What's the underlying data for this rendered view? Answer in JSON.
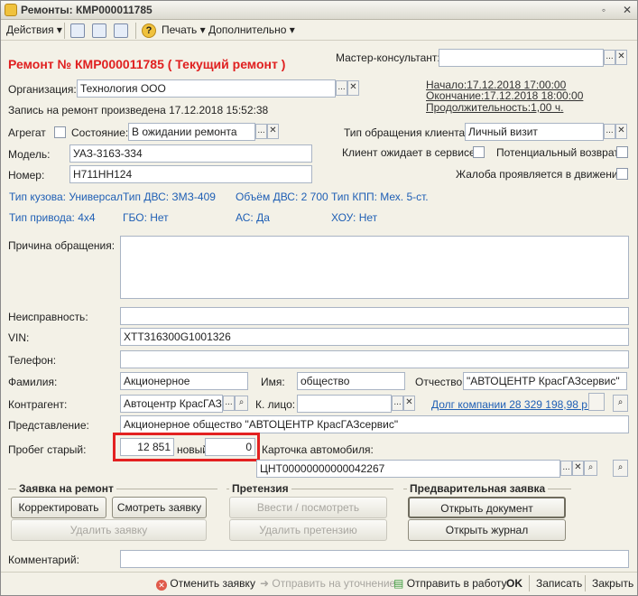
{
  "window": {
    "title": "Ремонты: КМР000011785"
  },
  "toolbar": {
    "actions": "Действия",
    "print": "Печать",
    "more": "Дополнительно"
  },
  "header": {
    "repair_title": "Ремонт № КМР000011785 ( Текущий ремонт )",
    "master_label": "Мастер-консультант:",
    "master_value": ""
  },
  "org": {
    "label": "Организация:",
    "value": "Технология ООО"
  },
  "record_text": "Запись на ремонт произведена 17.12.2018 15:52:38",
  "schedule": {
    "start": "Начало:17.12.2018 17:00:00",
    "end": "Окончание:17.12.2018 18:00:00",
    "duration": "Продолжительность:1,00 ч."
  },
  "aggregate_label": "Агрегат",
  "state": {
    "label": "Состояние:",
    "value": "В ожидании ремонта"
  },
  "appeal_type": {
    "label": "Тип обращения клиента:",
    "value": "Личный визит"
  },
  "model": {
    "label": "Модель:",
    "value": "УАЗ-3163-334"
  },
  "number": {
    "label": "Номер:",
    "value": "Н711НН124"
  },
  "client_waits": "Клиент ожидает в сервисе",
  "potential_return": "Потенциальный возврат",
  "complaint": "Жалоба проявляется в движении",
  "specs": [
    "Тип кузова: Универсал",
    "Тип ДВС: ЗМЗ-409",
    "Объём ДВС: 2 700",
    "Тип КПП: Мех. 5-ст.",
    "Тип привода: 4х4",
    "ГБО: Нет",
    "АС: Да",
    "ХОУ: Нет"
  ],
  "reason_label": "Причина обращения:",
  "fault_label": "Неисправность:",
  "vin": {
    "label": "VIN:",
    "value": "ХТТ316300G1001326"
  },
  "phone_label": "Телефон:",
  "surname": {
    "label": "Фамилия:",
    "value": "Акционерное"
  },
  "name": {
    "label": "Имя:",
    "value": "общество"
  },
  "patronymic": {
    "label": "Отчество:",
    "value": "\"АВТОЦЕНТР КрасГАЗсервис\""
  },
  "contractor": {
    "label": "Контрагент:",
    "value": "Автоцентр КрасГАЗсе"
  },
  "contact": {
    "label": "К. лицо:",
    "value": ""
  },
  "debt": "Долг компании 28 329 198,98 р...",
  "representation": {
    "label": "Представление:",
    "value": "Акционерное общество \"АВТОЦЕНТР КрасГАЗсервис\""
  },
  "mileage": {
    "label_old": "Пробег старый:",
    "old": "12 851",
    "label_new": "новый:",
    "new": "0"
  },
  "car_card": {
    "label": "Карточка автомобиля:",
    "value": "ЦНТ00000000000042267"
  },
  "groups": {
    "request": {
      "title": "Заявка на ремонт",
      "correct": "Корректировать",
      "view": "Смотреть заявку",
      "delete": "Удалить заявку"
    },
    "claim": {
      "title": "Претензия",
      "enter": "Ввести / посмотреть претензию",
      "delete": "Удалить претензию"
    },
    "prelim": {
      "title": "Предварительная заявка",
      "open_doc": "Открыть документ",
      "open_journal": "Открыть журнал"
    }
  },
  "comment_label": "Комментарий:",
  "bottom": {
    "cancel": "Отменить заявку",
    "send_clarify": "Отправить на уточнение",
    "send_work": "Отправить в работу",
    "ok": "OK",
    "save": "Записать",
    "close": "Закрыть"
  },
  "colors": {
    "accent_red": "#e02020",
    "link_blue": "#1f5fb5",
    "highlight": "#e32121"
  }
}
